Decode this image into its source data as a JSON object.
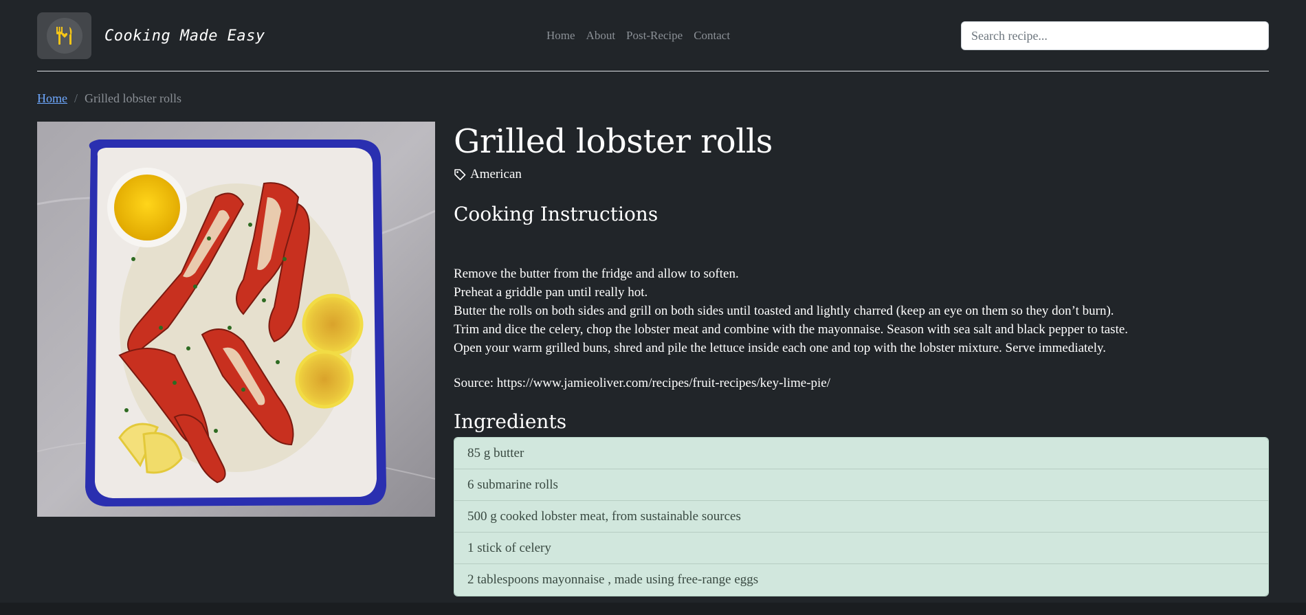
{
  "brand": {
    "name": "Cooking Made Easy",
    "logo_icon": "fork-heart-knife-icon",
    "accent": "#f5c518"
  },
  "nav": {
    "items": [
      "Home",
      "About",
      "Post-Recipe",
      "Contact"
    ]
  },
  "search": {
    "placeholder": "Search recipe..."
  },
  "breadcrumb": {
    "home": "Home",
    "separator": "/",
    "current": "Grilled lobster rolls"
  },
  "recipe": {
    "title": "Grilled lobster rolls",
    "tag_icon": "tag-icon",
    "cuisine": "American",
    "instructions_heading": "Cooking Instructions",
    "instructions": [
      "Remove the butter from the fridge and allow to soften.",
      "Preheat a griddle pan until really hot.",
      "Butter the rolls on both sides and grill on both sides until toasted and lightly charred (keep an eye on them so they don’t burn).",
      "Trim and dice the celery, chop the lobster meat and combine with the mayonnaise. Season with sea salt and black pepper to taste.",
      "Open your warm grilled buns, shred and pile the lettuce inside each one and top with the lobster mixture. Serve immediately."
    ],
    "source": "Source: https://www.jamieoliver.com/recipes/fruit-recipes/key-lime-pie/",
    "ingredients_heading": "Ingredients",
    "ingredients": [
      "85 g butter",
      "6 submarine rolls",
      "500 g cooked lobster meat, from sustainable sources",
      "1 stick of celery",
      "2 tablespoons mayonnaise , made using free-range eggs"
    ]
  }
}
